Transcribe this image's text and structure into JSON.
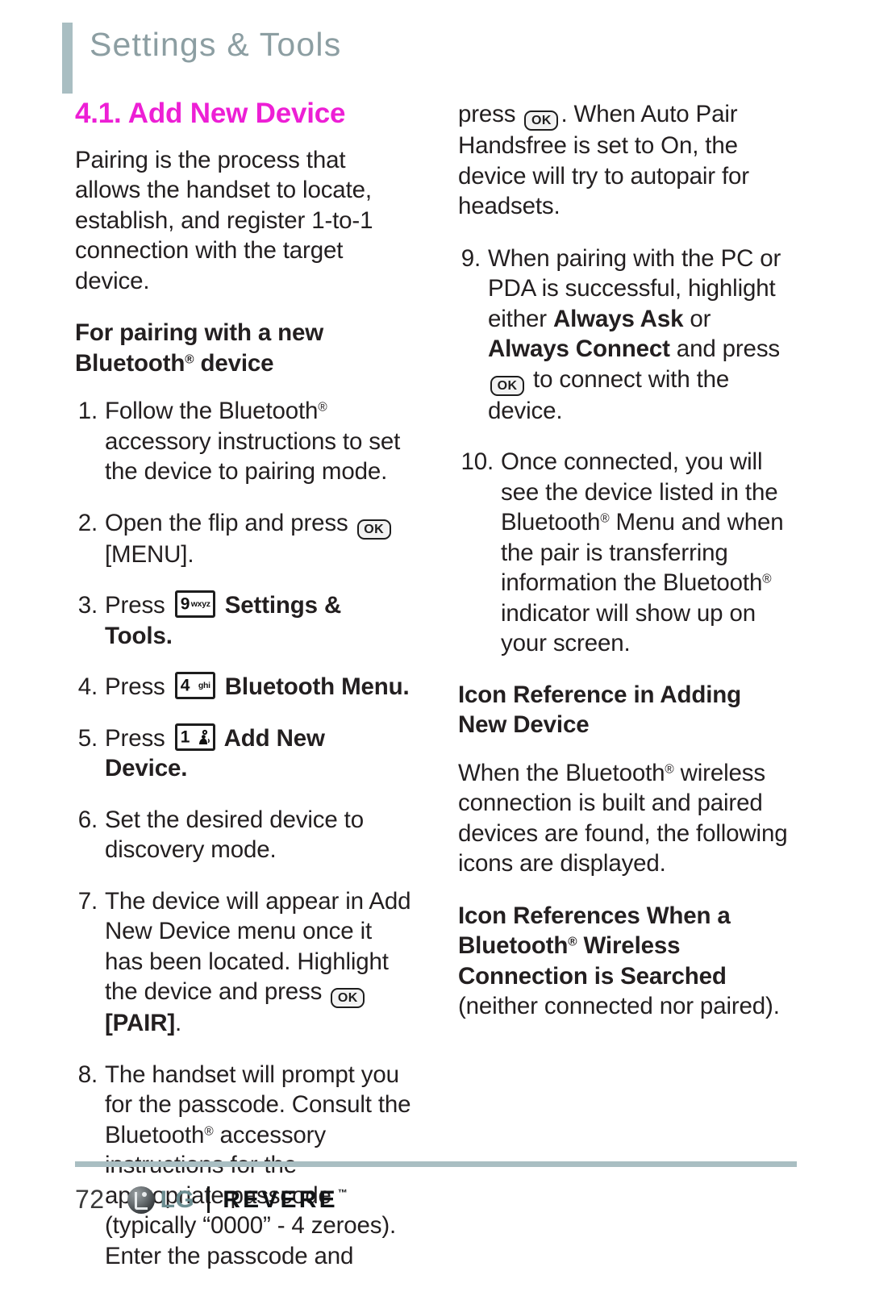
{
  "header": {
    "title": "Settings & Tools",
    "accent_color": "#a9bec2"
  },
  "section": {
    "title": "4.1. Add New Device",
    "color": "#ed1fd5"
  },
  "left_column": {
    "intro": "Pairing is the process that allows the handset to locate, establish, and register 1-to-1 connection with the target device.",
    "subheading_pairing_pre": "For pairing with a new Bluetooth",
    "subheading_pairing_post": " device",
    "steps": [
      {
        "number": "1.",
        "text_pre": "Follow the Bluetooth",
        "text_post": " accessory instructions to set the device to pairing mode."
      },
      {
        "number": "2.",
        "text_pre": "Open the flip and press ",
        "key": "OK",
        "text_post": " [MENU]."
      },
      {
        "number": "3.",
        "text_pre": "Press ",
        "key_digit": "9",
        "key_letters": "wxyz",
        "text_post": " Settings & Tools."
      },
      {
        "number": "4.",
        "text_pre": "Press ",
        "key_digit": "4",
        "key_letters": "ghi",
        "text_post": " Bluetooth Menu."
      },
      {
        "number": "5.",
        "text_pre": "Press ",
        "key_digit": "1",
        "key_letters": "voicemail-glyph",
        "text_post": " Add New Device."
      },
      {
        "number": "6.",
        "text": "Set the desired device to discovery mode."
      },
      {
        "number": "7.",
        "text_pre": "The device will appear in Add New Device menu once it has been located. Highlight the device and press ",
        "key": "OK",
        "text_bold": "[PAIR]",
        "text_post": "."
      },
      {
        "number": "8.",
        "text_part1": "The handset will prompt you for the passcode. Consult the Bluetooth",
        "text_part2": " accessory instructions for the appropriate passcode (typically “0000” - 4 zeroes). Enter the passcode and"
      }
    ]
  },
  "right_column": {
    "continuation": {
      "text_pre": "press ",
      "key": "OK",
      "text_post": ". When Auto Pair Handsfree is set to On, the device will try to autopair for headsets."
    },
    "steps": [
      {
        "number": "9.",
        "text_pre": "When pairing with the PC or PDA is successful, highlight either ",
        "bold1": "Always Ask",
        "mid": " or ",
        "bold2": "Always Connect",
        "text_mid2": " and press ",
        "key": "OK",
        "text_post": " to connect with the device."
      },
      {
        "number": "10.",
        "text_part1": "Once connected, you will see the device listed in the Bluetooth",
        "text_part2": " Menu and when the pair is transferring information the Bluetooth",
        "text_part3": " indicator will show up on your screen."
      }
    ],
    "subheading_icon_reference": "Icon Reference in Adding New Device",
    "paragraph_icons_pre": "When the Bluetooth",
    "paragraph_icons_post": " wireless connection is built and paired devices are found, the following icons are displayed.",
    "subheading_searched_pre": "Icon References When a Bluetooth",
    "subheading_searched_mid": " Wireless Connection is Searched",
    "subheading_searched_post": " (neither connected nor paired)."
  },
  "footer": {
    "page_number": "72",
    "brand": "LG",
    "model": "REVERE",
    "trademark": "™",
    "rule_color": "#a9bec2"
  }
}
